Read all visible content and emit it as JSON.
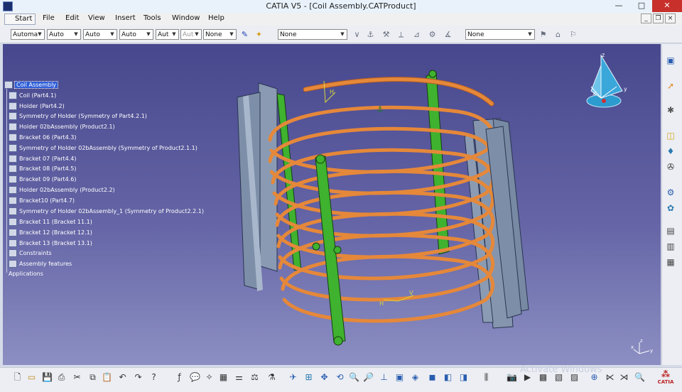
{
  "window": {
    "title": "CATIA V5 - [Coil Assembly.CATProduct]",
    "minimize": "—",
    "maximize": "□",
    "close": "✕"
  },
  "menu": [
    "Start",
    "File",
    "Edit",
    "View",
    "Insert",
    "Tools",
    "Window",
    "Help"
  ],
  "mdi": {
    "min": "_",
    "restore": "❐",
    "close": "×"
  },
  "toolbar": {
    "dropdowns": [
      "Automa",
      "Auto",
      "Auto",
      "Auto",
      "Aut",
      "Aut",
      "None"
    ],
    "layer_filter": "None",
    "layer_filter2": "None"
  },
  "tree": {
    "root": "Coil Assembly",
    "items": [
      "Coil (Part4.1)",
      "Holder (Part4.2)",
      "Symmetry of Holder (Symmetry of Part4.2.1)",
      "Holder 02bAssembly (Product2.1)",
      "Bracket 06 (Part4.3)",
      "Symmetry of Holder 02bAssembly (Symmetry of Product2.1.1)",
      "Bracket 07 (Part4.4)",
      "Bracket 08 (Part4.5)",
      "Bracket 09 (Part4.6)",
      "Holder 02bAssembly (Product2.2)",
      "Bracket10 (Part4.7)",
      "Symmetry of Holder 02bAssembly_1 (Symmetry of Product2.2.1)",
      "Bracket 11 (Bracket 11.1)",
      "Bracket 12 (Bracket 12.1)",
      "Bracket 13 (Bracket 13.1)",
      "Constraints",
      "Assembly features",
      "Applications"
    ]
  },
  "compass": {
    "z": "z",
    "x": "x",
    "y": "y"
  },
  "axis_small": {
    "z": "z",
    "y": "y",
    "x": "x"
  },
  "model_labels": {
    "h1": "H",
    "h2": "H",
    "v": "V"
  },
  "watermark": "Activate Windows",
  "catia_logo": "CATIA",
  "colors": {
    "coil": "#e5883a",
    "bracket": "#3fb22f",
    "holder": "#7d8fa8",
    "viewport_top": "#47478d",
    "viewport_bottom": "#8c8fc2"
  }
}
